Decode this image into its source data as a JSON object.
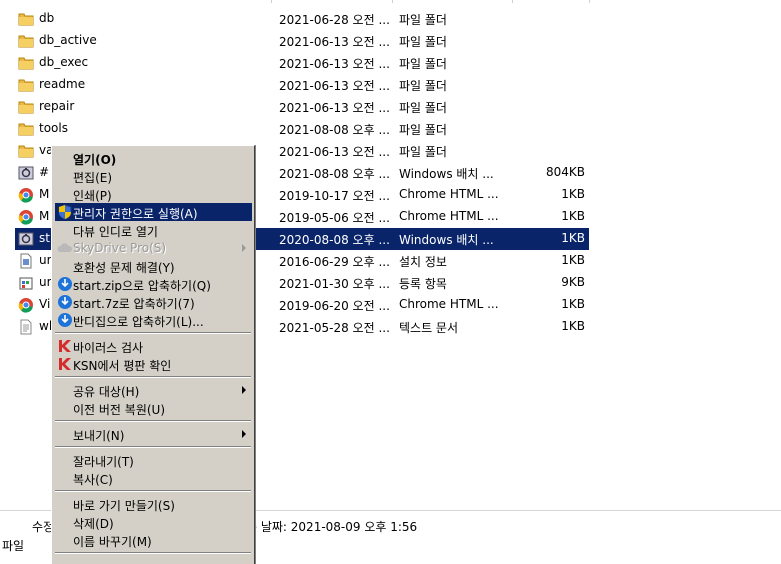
{
  "files": [
    {
      "name": "db",
      "date": "2021-06-28 오전 ...",
      "type": "파일 폴더",
      "size": "",
      "icon": "folder-icon"
    },
    {
      "name": "db_active",
      "date": "2021-06-13 오전 ...",
      "type": "파일 폴더",
      "size": "",
      "icon": "folder-icon"
    },
    {
      "name": "db_exec",
      "date": "2021-06-13 오전 ...",
      "type": "파일 폴더",
      "size": "",
      "icon": "folder-icon"
    },
    {
      "name": "readme",
      "date": "2021-06-13 오전 ...",
      "type": "파일 폴더",
      "size": "",
      "icon": "folder-icon"
    },
    {
      "name": "repair",
      "date": "2021-06-13 오전 ...",
      "type": "파일 폴더",
      "size": "",
      "icon": "folder-icon"
    },
    {
      "name": "tools",
      "date": "2021-08-08 오후 ...",
      "type": "파일 폴더",
      "size": "",
      "icon": "folder-icon"
    },
    {
      "name": "va",
      "date": "2021-06-13 오전 ...",
      "type": "파일 폴더",
      "size": "",
      "icon": "folder-icon"
    },
    {
      "name": "#",
      "date": "2021-08-08 오후 ...",
      "type": "Windows 배치 ...",
      "size": "804KB",
      "icon": "batch-file-icon"
    },
    {
      "name": "M",
      "date": "2019-10-17 오전 ...",
      "type": "Chrome HTML ...",
      "size": "1KB",
      "icon": "chrome-icon"
    },
    {
      "name": "M",
      "date": "2019-05-06 오전 ...",
      "type": "Chrome HTML ...",
      "size": "1KB",
      "icon": "chrome-icon"
    },
    {
      "name": "st",
      "date": "2020-08-08 오후 ...",
      "type": "Windows 배치 ...",
      "size": "1KB",
      "icon": "batch-file-icon"
    },
    {
      "name": "ur",
      "date": "2016-06-29 오후 ...",
      "type": "설치 정보",
      "size": "1KB",
      "icon": "setup-info-icon"
    },
    {
      "name": "ur",
      "date": "2021-01-30 오후 ...",
      "type": "등록 항목",
      "size": "9KB",
      "icon": "registry-icon"
    },
    {
      "name": "Vi",
      "date": "2019-06-20 오전 ...",
      "type": "Chrome HTML ...",
      "size": "1KB",
      "icon": "chrome-icon"
    },
    {
      "name": "wl",
      "date": "2021-05-28 오전 ...",
      "type": "텍스트 문서",
      "size": "1KB",
      "icon": "text-file-icon"
    }
  ],
  "selected_row_index": 10,
  "status": {
    "left_text": "수정",
    "modified": "든 날짜: 2021-08-09 오후 1:56",
    "type": "파일"
  },
  "context_menu": {
    "items": [
      {
        "label": "열기(O)",
        "bold": true
      },
      {
        "label": "편집(E)"
      },
      {
        "label": "인쇄(P)"
      },
      {
        "label": "관리자 권한으로 실행(A)",
        "icon": "uac-shield-icon",
        "highlight": true
      },
      {
        "label": "다뷰 인디로 열기"
      },
      {
        "label": "SkyDrive Pro(S)",
        "icon": "skydrive-icon",
        "disabled": true,
        "submenu": true
      },
      {
        "label": "호환성 문제 해결(Y)"
      },
      {
        "label": "start.zip으로 압축하기(Q)",
        "icon": "bandizip-icon"
      },
      {
        "label": "start.7z로 압축하기(7)",
        "icon": "bandizip-icon"
      },
      {
        "label": "반디집으로 압축하기(L)...",
        "icon": "bandizip-icon"
      },
      {
        "sep": true
      },
      {
        "label": "바이러스 검사",
        "icon": "kaspersky-icon"
      },
      {
        "label": "KSN에서 평판 확인",
        "icon": "kaspersky-icon"
      },
      {
        "sep": true
      },
      {
        "label": "공유 대상(H)",
        "submenu": true
      },
      {
        "label": "이전 버전 복원(U)"
      },
      {
        "sep": true
      },
      {
        "label": "보내기(N)",
        "submenu": true
      },
      {
        "sep": true
      },
      {
        "label": "잘라내기(T)"
      },
      {
        "label": "복사(C)"
      },
      {
        "sep": true
      },
      {
        "label": "바로 가기 만들기(S)"
      },
      {
        "label": "삭제(D)"
      },
      {
        "label": "이름 바꾸기(M)"
      },
      {
        "sep": true
      }
    ]
  },
  "colors": {
    "selection": "#0a246a",
    "menu_bg": "#d4d0c8"
  }
}
